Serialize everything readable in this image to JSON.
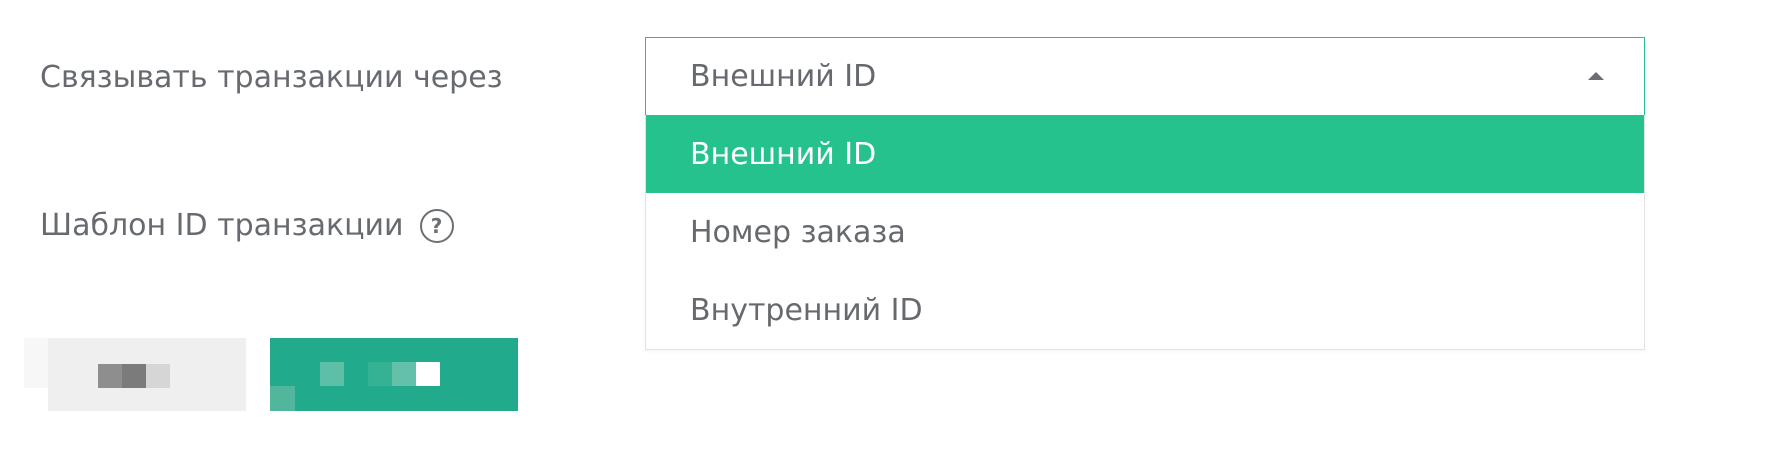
{
  "form": {
    "link_label": "Связывать транзакции через",
    "template_label": "Шаблон ID транзакции",
    "help_glyph": "?"
  },
  "link_select": {
    "value": "Внешний ID",
    "expanded": true,
    "options": [
      {
        "label": "Внешний ID",
        "selected": true
      },
      {
        "label": "Номер заказа",
        "selected": false
      },
      {
        "label": "Внутренний ID",
        "selected": false
      }
    ]
  },
  "buttons": {
    "secondary_obscured": true,
    "primary_obscured": true
  },
  "colors": {
    "accent": "#26c28e",
    "primary_button": "#22aa8c",
    "secondary_button": "#efefef",
    "text": "#676b70"
  },
  "icons": {
    "help": "question-circle-icon",
    "caret": "caret-up-icon"
  }
}
